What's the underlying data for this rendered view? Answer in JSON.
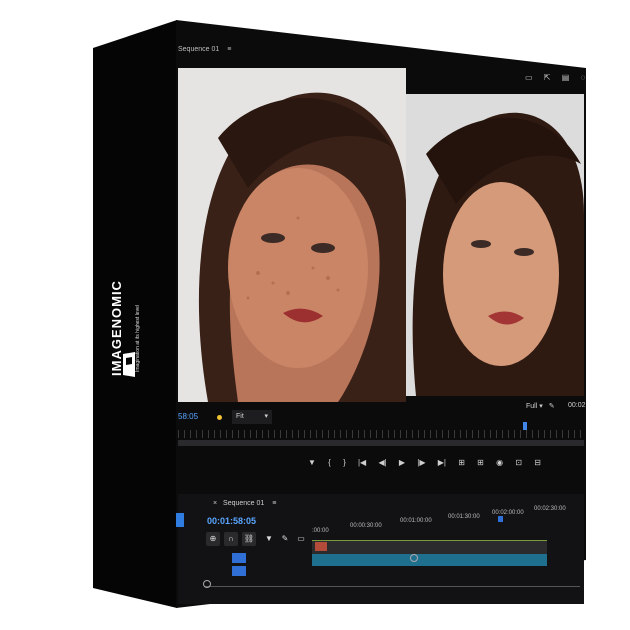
{
  "brand": {
    "name": "IMAGENOMIC",
    "tagline": "Imagination at its highest level"
  },
  "monitor": {
    "sequence_tab": "Sequence 01",
    "timecode": "58:05",
    "fit_label": "Fit",
    "full_label": "Full",
    "right_timecode": "00:02"
  },
  "timeline": {
    "tab": "Sequence 01",
    "timecode": "00:01:58:05",
    "ruler": [
      ":00:00",
      "00:00:30:00",
      "00:01:00:00",
      "00:01:30:00",
      "00:02:00:00",
      "00:02:30:00"
    ]
  },
  "transport": {
    "buttons": [
      "▼",
      "{",
      "}",
      "|◀",
      "◀|",
      "▶",
      "|▶",
      "▶|",
      "⊞",
      "⊞",
      "◉",
      "⊡",
      "⊟"
    ]
  },
  "colors": {
    "accent": "#3f86e8",
    "timecode": "#5aa6ff",
    "track_video": "#1f6f8e",
    "clip": "#b24b3a"
  }
}
